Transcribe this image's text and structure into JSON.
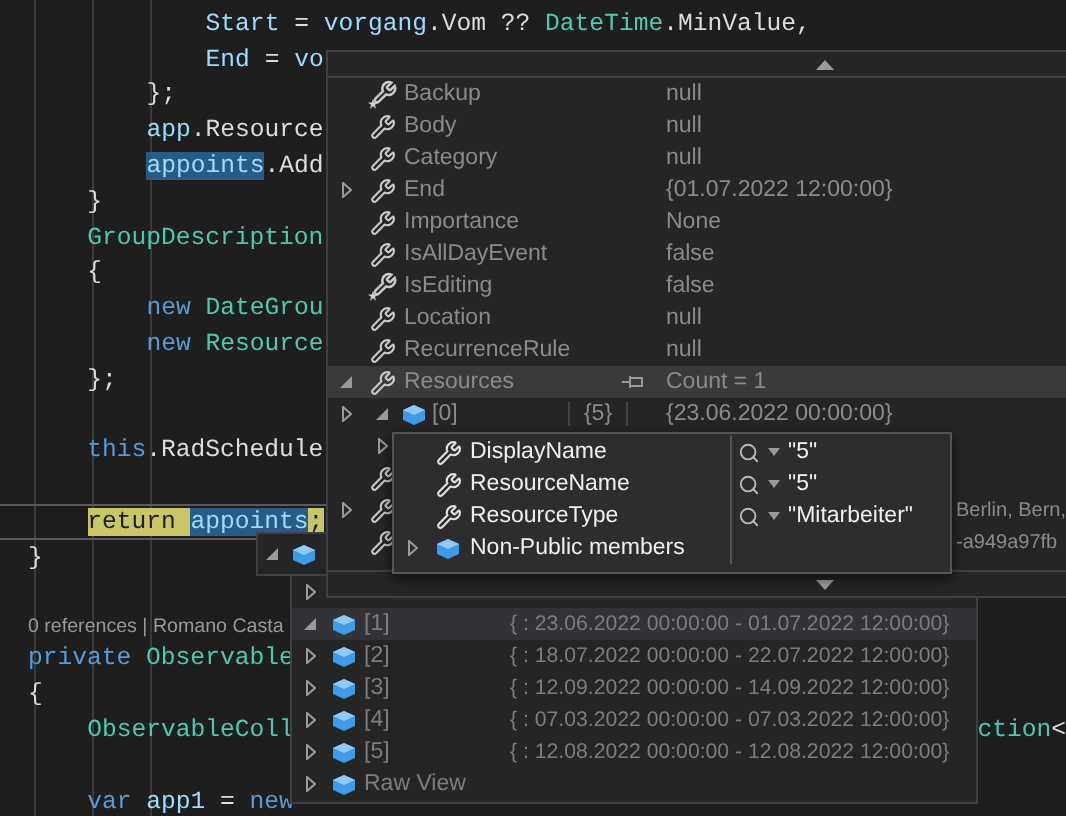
{
  "code_lines": [
    {
      "kind": "initializer",
      "current": false,
      "tokens": [
        {
          "text": "Start",
          "kind": "variable"
        },
        {
          "text": " = ",
          "kind": "plain"
        },
        {
          "text": "vorgang",
          "kind": "variable"
        },
        {
          "text": ".Vom ?? ",
          "kind": "plain"
        },
        {
          "text": "DateTime",
          "kind": "type"
        },
        {
          "text": ".MinValue,",
          "kind": "plain"
        }
      ]
    },
    {
      "kind": "initializer",
      "current": false,
      "tokens": [
        {
          "text": "End",
          "kind": "variable"
        },
        {
          "text": " = ",
          "kind": "plain"
        },
        {
          "text": "vo",
          "kind": "variable"
        }
      ]
    },
    {
      "kind": "inner",
      "current": false,
      "tokens": [
        {
          "text": "};",
          "kind": "plain"
        }
      ]
    },
    {
      "kind": "inner",
      "current": false,
      "tokens": [
        {
          "text": "app",
          "kind": "variable"
        },
        {
          "text": ".Resource",
          "kind": "plain"
        }
      ]
    },
    {
      "kind": "inner",
      "current": false,
      "tokens": [
        {
          "text": "appoints",
          "kind": "selected"
        },
        {
          "text": ".Add",
          "kind": "plain"
        }
      ]
    },
    {
      "kind": "method",
      "current": false,
      "tokens": [
        {
          "text": "}",
          "kind": "plain"
        }
      ]
    },
    {
      "kind": "method",
      "current": false,
      "tokens": [
        {
          "text": "GroupDescription",
          "kind": "type"
        }
      ]
    },
    {
      "kind": "method",
      "current": false,
      "tokens": [
        {
          "text": "{",
          "kind": "plain"
        }
      ]
    },
    {
      "kind": "inner",
      "current": false,
      "tokens": [
        {
          "text": "new ",
          "kind": "keyword"
        },
        {
          "text": "DateGrou",
          "kind": "type"
        }
      ]
    },
    {
      "kind": "inner",
      "current": false,
      "tokens": [
        {
          "text": "new ",
          "kind": "keyword"
        },
        {
          "text": "Resource",
          "kind": "type"
        }
      ]
    },
    {
      "kind": "method",
      "current": false,
      "tokens": [
        {
          "text": "};",
          "kind": "plain"
        }
      ]
    },
    {
      "kind": "blank"
    },
    {
      "kind": "method",
      "current": false,
      "tokens": [
        {
          "text": "this",
          "kind": "keyword"
        },
        {
          "text": ".RadSchedule",
          "kind": "plain"
        }
      ]
    },
    {
      "kind": "blank"
    },
    {
      "kind": "method",
      "current": true,
      "tokens": [
        {
          "text": "return ",
          "kind": "statement"
        },
        {
          "text": "appoints",
          "kind": "selected"
        },
        {
          "text": ";",
          "kind": "statement"
        }
      ]
    },
    {
      "kind": "class",
      "current": false,
      "tokens": [
        {
          "text": "}",
          "kind": "plain"
        }
      ]
    },
    {
      "kind": "blank"
    },
    {
      "kind": "codelens",
      "text": "0 references | Romano Casta"
    },
    {
      "kind": "class",
      "current": false,
      "tokens": [
        {
          "text": "private ",
          "kind": "keyword"
        },
        {
          "text": "Observable",
          "kind": "type"
        }
      ]
    },
    {
      "kind": "class",
      "current": false,
      "tokens": [
        {
          "text": "{",
          "kind": "plain"
        }
      ]
    },
    {
      "kind": "method",
      "current": false,
      "tokens": [
        {
          "text": "ObservableColl",
          "kind": "type"
        }
      ],
      "tail_tokens": [
        {
          "text": "ction",
          "kind": "type"
        },
        {
          "text": "<",
          "kind": "plain"
        }
      ]
    },
    {
      "kind": "blank"
    },
    {
      "kind": "method",
      "current": false,
      "tokens": [
        {
          "text": "var ",
          "kind": "keyword"
        },
        {
          "text": "app1",
          "kind": "variable"
        },
        {
          "text": " = ",
          "kind": "plain"
        },
        {
          "text": "new",
          "kind": "keyword"
        }
      ]
    }
  ],
  "root_tip": {
    "kind": "object",
    "expanded": true
  },
  "properties_tip": {
    "rows": [
      {
        "name": "Backup",
        "value": "null",
        "kind": "new-property",
        "selected": false
      },
      {
        "name": "Body",
        "value": "null",
        "kind": "property",
        "selected": false
      },
      {
        "name": "Category",
        "value": "null",
        "kind": "property",
        "selected": false
      },
      {
        "name": "End",
        "value": "{01.07.2022 12:00:00}",
        "kind": "property",
        "expanded": false,
        "selected": false
      },
      {
        "name": "Importance",
        "value": "None",
        "kind": "property",
        "selected": false
      },
      {
        "name": "IsAllDayEvent",
        "value": "false",
        "kind": "property",
        "selected": false
      },
      {
        "name": "IsEditing",
        "value": "false",
        "kind": "new-property",
        "selected": false
      },
      {
        "name": "Location",
        "value": "null",
        "kind": "property",
        "selected": false
      },
      {
        "name": "RecurrenceRule",
        "value": "null",
        "kind": "property",
        "selected": false
      },
      {
        "name": "Resources",
        "value": "Count = 1",
        "kind": "property",
        "expanded": true,
        "selected": true
      }
    ],
    "nested_row": {
      "expanded": false,
      "item": {
        "kind": "object",
        "expanded": true,
        "name": "[0]",
        "count": "{5}",
        "value": "{23.06.2022 00:00:00}"
      }
    },
    "covered_rows": [
      {
        "kind": "nested",
        "item": {
          "expanded": false
        }
      },
      {
        "kind": "property"
      },
      {
        "kind": "property",
        "expanded": false,
        "value": "Berlin, Bern,"
      },
      {
        "kind": "property",
        "value": "-a949a97fb"
      }
    ]
  },
  "members_tip": {
    "rows": [
      {
        "name": "DisplayName",
        "value": "\"5\"",
        "kind": "property"
      },
      {
        "name": "ResourceName",
        "value": "\"5\"",
        "kind": "property"
      },
      {
        "name": "ResourceType",
        "value": "\"Mitarbeiter\"",
        "kind": "property"
      },
      {
        "name": "Non-Public members",
        "kind": "object",
        "expanded": false
      }
    ]
  },
  "items_tip": {
    "rows": [
      {
        "kind": "covered",
        "expanded": false,
        "selected": false
      },
      {
        "name": "[1]",
        "value": "{ : 23.06.2022 00:00:00 - 01.07.2022 12:00:00}",
        "kind": "object",
        "expanded": true,
        "selected": true
      },
      {
        "name": "[2]",
        "value": "{ : 18.07.2022 00:00:00 - 22.07.2022 12:00:00}",
        "kind": "object",
        "expanded": false,
        "selected": false
      },
      {
        "name": "[3]",
        "value": "{ : 12.09.2022 00:00:00 - 14.09.2022 12:00:00}",
        "kind": "object",
        "expanded": false,
        "selected": false
      },
      {
        "name": "[4]",
        "value": "{ : 07.03.2022 00:00:00 - 07.03.2022 12:00:00}",
        "kind": "object",
        "expanded": false,
        "selected": false
      },
      {
        "name": "[5]",
        "value": "{ : 12.08.2022 00:00:00 - 12.08.2022 12:00:00}",
        "kind": "object",
        "expanded": false,
        "selected": false
      },
      {
        "name": "Raw View",
        "kind": "object",
        "expanded": false,
        "selected": false
      }
    ]
  }
}
